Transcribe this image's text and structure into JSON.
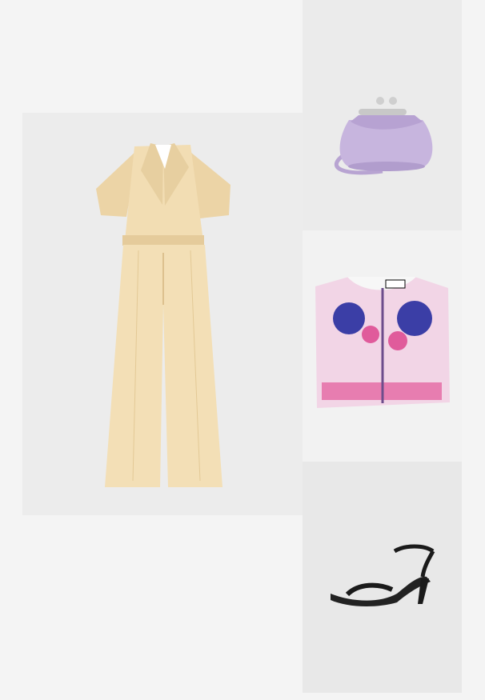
{
  "collage": {
    "items": [
      {
        "name": "jumpsuit",
        "color": "#f0dbb2"
      },
      {
        "name": "clutch-bag",
        "color": "#c8b6dd"
      },
      {
        "name": "cropped-top",
        "color": "#e89ac4"
      },
      {
        "name": "sandal",
        "color": "#1a1a1a"
      }
    ]
  }
}
